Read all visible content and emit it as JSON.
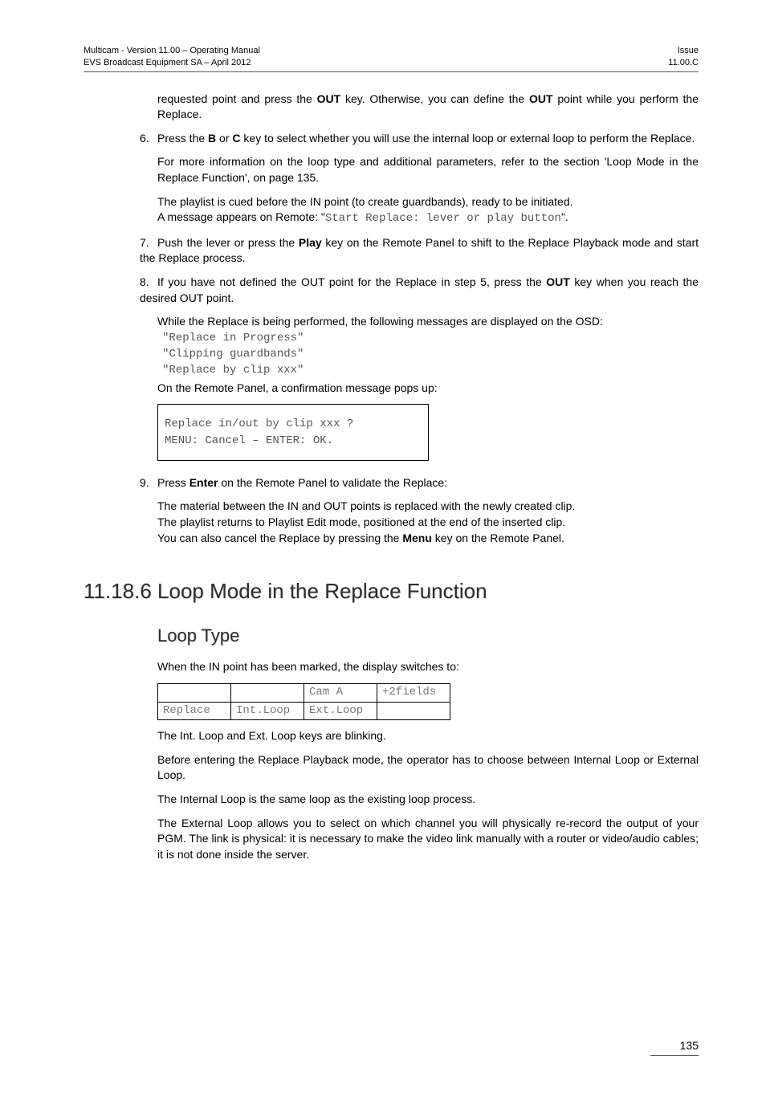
{
  "header": {
    "left_line1": "Multicam - Version 11.00 – Operating Manual",
    "left_line2": "EVS Broadcast Equipment SA – April 2012",
    "right_line1": "Issue",
    "right_line2": "11.00.C"
  },
  "para_intro": {
    "pre1": "requested point and press the ",
    "b1": "OUT",
    "mid1": " key. Otherwise, you can define the ",
    "b2": "OUT",
    "post1": " point while you perform the Replace."
  },
  "step6": {
    "num": "6.",
    "pre": "Press the ",
    "b1": "B",
    "mid1": " or ",
    "b2": "C",
    "post": " key to select whether you will use the internal loop or external loop to perform the Replace."
  },
  "step6_follow1": "For more information on the loop type and additional parameters, refer to the section 'Loop Mode in the Replace Function', on page 135.",
  "step6_follow2": "The playlist is cued before the IN point (to create guardbands), ready to be initiated.",
  "step6_follow3_pre": "A message appears on Remote: \"",
  "step6_follow3_code": "Start Replace: lever or play button",
  "step6_follow3_post": "\".",
  "step7": {
    "num": "7.",
    "pre": "Push the lever or press the ",
    "b1": "Play",
    "post": " key on the Remote Panel to shift to the Replace Playback mode and start the Replace process."
  },
  "step8": {
    "num": "8.",
    "pre": "If you have not defined the OUT point for the Replace in step 5, press the ",
    "b1": "OUT",
    "post": " key when you reach the desired OUT point."
  },
  "step8_follow1": "While the Replace is being performed, the following messages are displayed on the OSD:",
  "osd_line1": "\"Replace in Progress\"",
  "osd_line2": "\"Clipping guardbands\"",
  "osd_line3": "\"Replace by clip xxx\"",
  "step8_follow2": "On the Remote Panel, a confirmation message pops up:",
  "box_line1": "Replace in/out by clip xxx ?",
  "box_line2": "MENU: Cancel – ENTER: OK.",
  "step9": {
    "num": "9.",
    "pre": "Press ",
    "b1": "Enter",
    "post": " on the Remote Panel to validate the Replace:"
  },
  "step9_follow1": "The material between the IN and OUT points is replaced with the newly created clip.",
  "step9_follow2": "The playlist returns to Playlist Edit mode, positioned at the end of the inserted clip.",
  "step9_follow3_pre": "You can also cancel the Replace by pressing the ",
  "step9_follow3_b": "Menu",
  "step9_follow3_post": " key on the Remote Panel.",
  "section_heading": "11.18.6  Loop Mode in the Replace Function",
  "sub_heading": "Loop Type",
  "loop_p1": "When the IN point has been marked, the display switches to:",
  "table": {
    "r1c1": "",
    "r1c2": "",
    "r1c3": "Cam A",
    "r1c4": "+2fields",
    "r2c1": "Replace",
    "r2c2": "Int.Loop",
    "r2c3": "Ext.Loop",
    "r2c4": ""
  },
  "loop_p2": "The Int. Loop and Ext. Loop keys are blinking.",
  "loop_p3": "Before entering the Replace Playback mode, the operator has to choose between Internal Loop or External Loop.",
  "loop_p4": "The Internal Loop is the same loop as the existing loop process.",
  "loop_p5": "The External Loop allows you to select on which channel you will physically re-record the output of your PGM. The link is physical: it is necessary to make the video link manually with a router or video/audio cables; it is not done inside the server.",
  "page_number": "135"
}
